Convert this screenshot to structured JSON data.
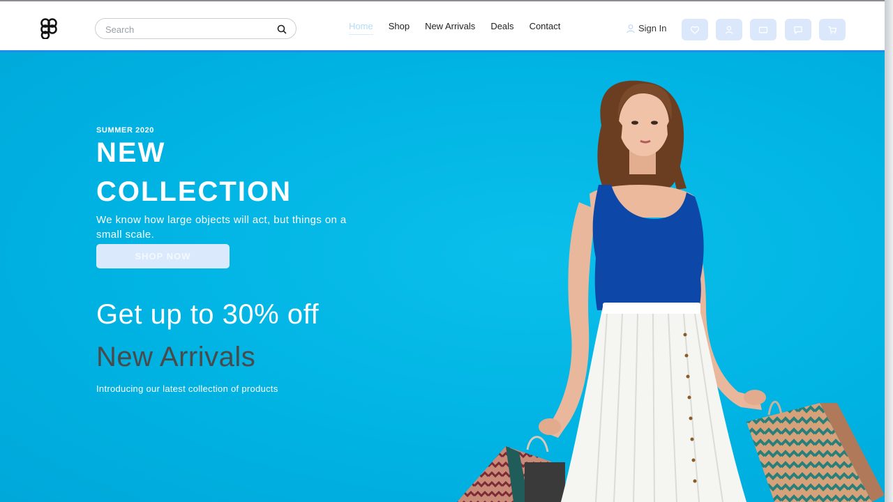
{
  "header": {
    "logo_icon": "figma-logo-icon",
    "search": {
      "placeholder": "Search",
      "value": "",
      "icon": "search-icon"
    },
    "nav": [
      {
        "label": "Home",
        "active": true
      },
      {
        "label": "Shop",
        "active": false
      },
      {
        "label": "New Arrivals",
        "active": false
      },
      {
        "label": "Deals",
        "active": false
      },
      {
        "label": "Contact",
        "active": false
      }
    ],
    "signin": {
      "label": "Sign In",
      "icon": "user-outline-icon"
    },
    "icon_buttons": [
      {
        "name": "wishlist",
        "icon": "heart-icon"
      },
      {
        "name": "account",
        "icon": "user-icon"
      },
      {
        "name": "wallet",
        "icon": "card-icon"
      },
      {
        "name": "messages",
        "icon": "chat-icon"
      },
      {
        "name": "cart",
        "icon": "cart-icon"
      }
    ],
    "accent_color": "#1e8fe6",
    "icon_button_color": "#dbe8fc"
  },
  "hero": {
    "season": "SUMMER 2020",
    "headline_line1": "NEW",
    "headline_line2": "COLLECTION",
    "description": "We know how large objects will act, but things on a small scale.",
    "cta_label": "SHOP NOW",
    "offer": "Get up to 30% off",
    "subheading": "New Arrivals",
    "intro": "Introducing our latest collection of products",
    "background_color": "#00b4e4",
    "image": "model-with-shopping-bags"
  }
}
